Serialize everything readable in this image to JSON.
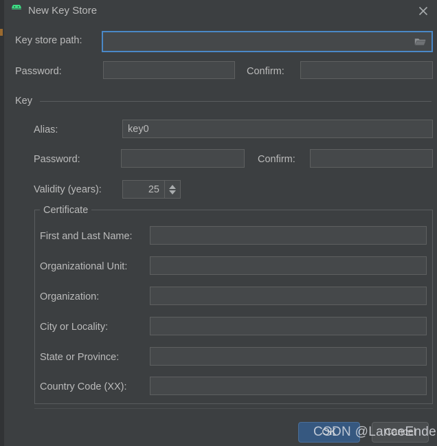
{
  "window": {
    "title": "New Key Store",
    "app_icon": "android-robot-icon",
    "close_icon": "close-icon",
    "accent_focus_color": "#4a88c7",
    "background_color": "#3c3f41",
    "field_color": "#45484a"
  },
  "keystore": {
    "path_label": "Key store path:",
    "path_value": "",
    "path_placeholder": "",
    "browse_icon": "folder-icon",
    "password_label": "Password:",
    "password_value": "",
    "confirm_label": "Confirm:",
    "confirm_value": ""
  },
  "key_group": {
    "title": "Key",
    "alias_label": "Alias:",
    "alias_value": "key0",
    "password_label": "Password:",
    "password_value": "",
    "confirm_label": "Confirm:",
    "confirm_value": "",
    "validity_label": "Validity (years):",
    "validity_value": "25",
    "spinner_up_icon": "chevron-up-icon",
    "spinner_down_icon": "chevron-down-icon"
  },
  "certificate_group": {
    "title": "Certificate",
    "fields": [
      {
        "label": "First and Last Name:",
        "value": ""
      },
      {
        "label": "Organizational Unit:",
        "value": ""
      },
      {
        "label": "Organization:",
        "value": ""
      },
      {
        "label": "City or Locality:",
        "value": ""
      },
      {
        "label": "State or Province:",
        "value": ""
      },
      {
        "label": "Country Code (XX):",
        "value": ""
      }
    ]
  },
  "footer": {
    "ok_label": "OK",
    "cancel_label": "Cancel"
  },
  "watermark": {
    "text": "CSDN @LanceEnder"
  }
}
